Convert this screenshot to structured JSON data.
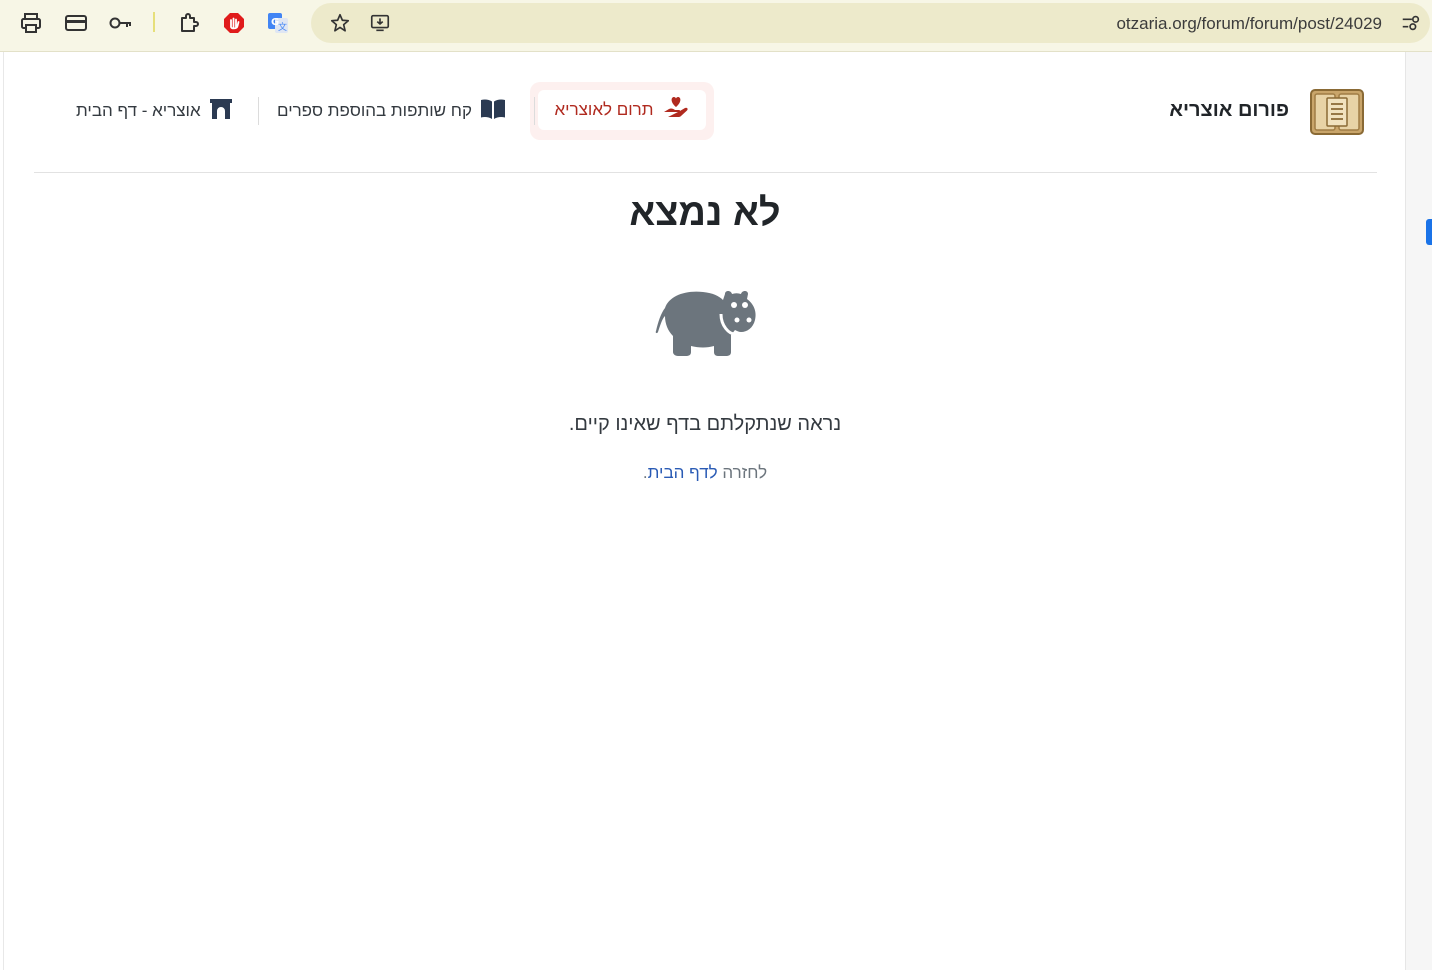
{
  "browser": {
    "url": "otzaria.org/forum/forum/post/24029"
  },
  "header": {
    "site_title": "פורום אוצריא",
    "donate_label": "תרום לאוצריא",
    "nav_books_label": "קח שותפות בהוספת ספרים",
    "nav_home_label": "אוצריא - דף הבית"
  },
  "main": {
    "title": "לא נמצא",
    "message": "נראה שנתקלתם בדף שאינו קיים.",
    "back_prefix": "לחזרה ",
    "back_link": "לדף הבית",
    "back_suffix": "."
  },
  "colors": {
    "accent_link": "#2a5bb5",
    "donate_text": "#b02a1f",
    "hippo": "#6c757d"
  },
  "icons": {
    "toolbar": [
      "print-icon",
      "credit-card-icon",
      "key-icon",
      "extensions-icon",
      "adblock-icon",
      "translate-icon",
      "star-icon",
      "install-app-icon",
      "site-settings-icon"
    ],
    "nav": [
      "hand-heart-icon",
      "book-open-icon",
      "archway-icon",
      "hippo-icon"
    ]
  }
}
